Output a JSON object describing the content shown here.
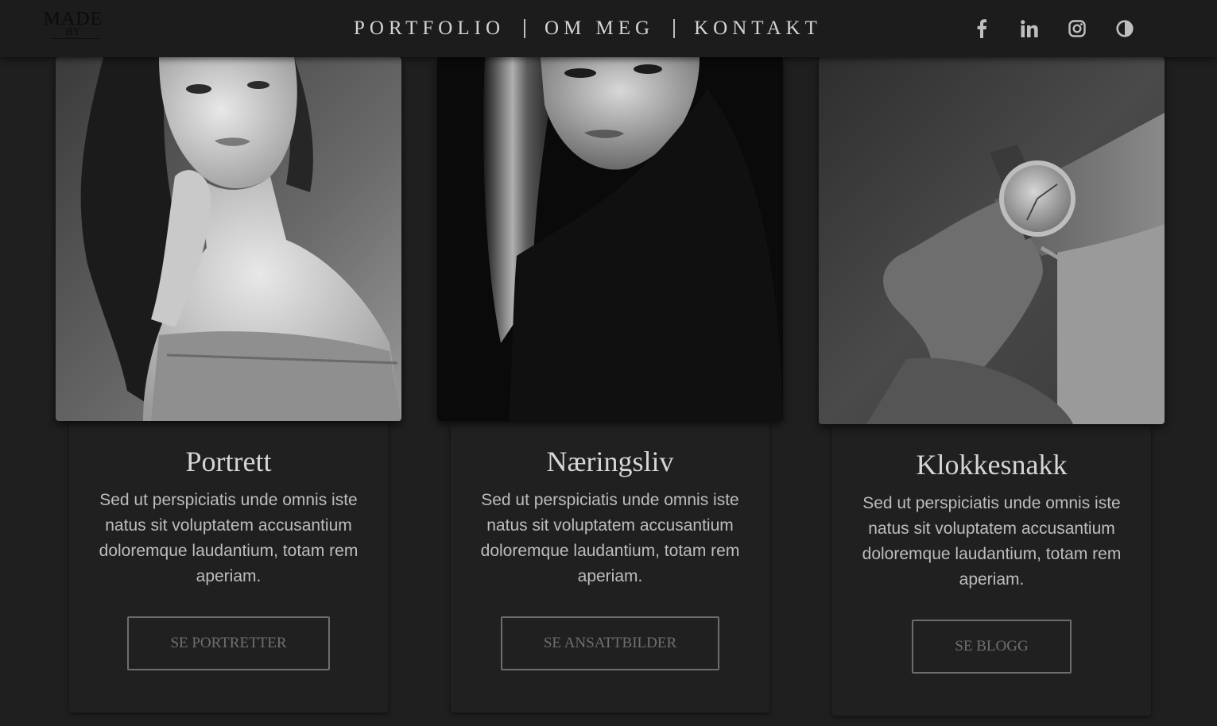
{
  "brand": {
    "logo_line1": "MADE",
    "logo_line2": "BY"
  },
  "nav": {
    "items": [
      {
        "label": "PORTFOLIO"
      },
      {
        "label": "OM MEG"
      },
      {
        "label": "KONTAKT"
      }
    ]
  },
  "socials": [
    {
      "icon": "facebook-icon"
    },
    {
      "icon": "linkedin-icon"
    },
    {
      "icon": "instagram-icon"
    },
    {
      "icon": "contrast-toggle-icon"
    }
  ],
  "colors": {
    "background": "#1f1f1f",
    "header": "#1c1c1c",
    "text": "#d6d6d6",
    "button_border": "#6d6d6d"
  },
  "cards": [
    {
      "title": "Portrett",
      "description": "Sed ut perspiciatis unde omnis iste natus sit voluptatem accusantium doloremque laudantium, totam rem aperiam.",
      "button": "SE PORTRETTER",
      "image": "black-and-white portrait of a woman"
    },
    {
      "title": "Næringsliv",
      "description": "Sed ut perspiciatis unde omnis iste natus sit voluptatem accusantium doloremque laudantium, totam rem aperiam.",
      "button": "SE ANSATTBILDER",
      "image": "black-and-white portrait of a woman in dark clothing"
    },
    {
      "title": "Klokkesnakk",
      "description": "Sed ut perspiciatis unde omnis iste natus sit voluptatem accusantium doloremque laudantium, totam rem aperiam.",
      "button": "SE BLOGG",
      "image": "black-and-white photo of a wristwatch on an arm"
    }
  ]
}
